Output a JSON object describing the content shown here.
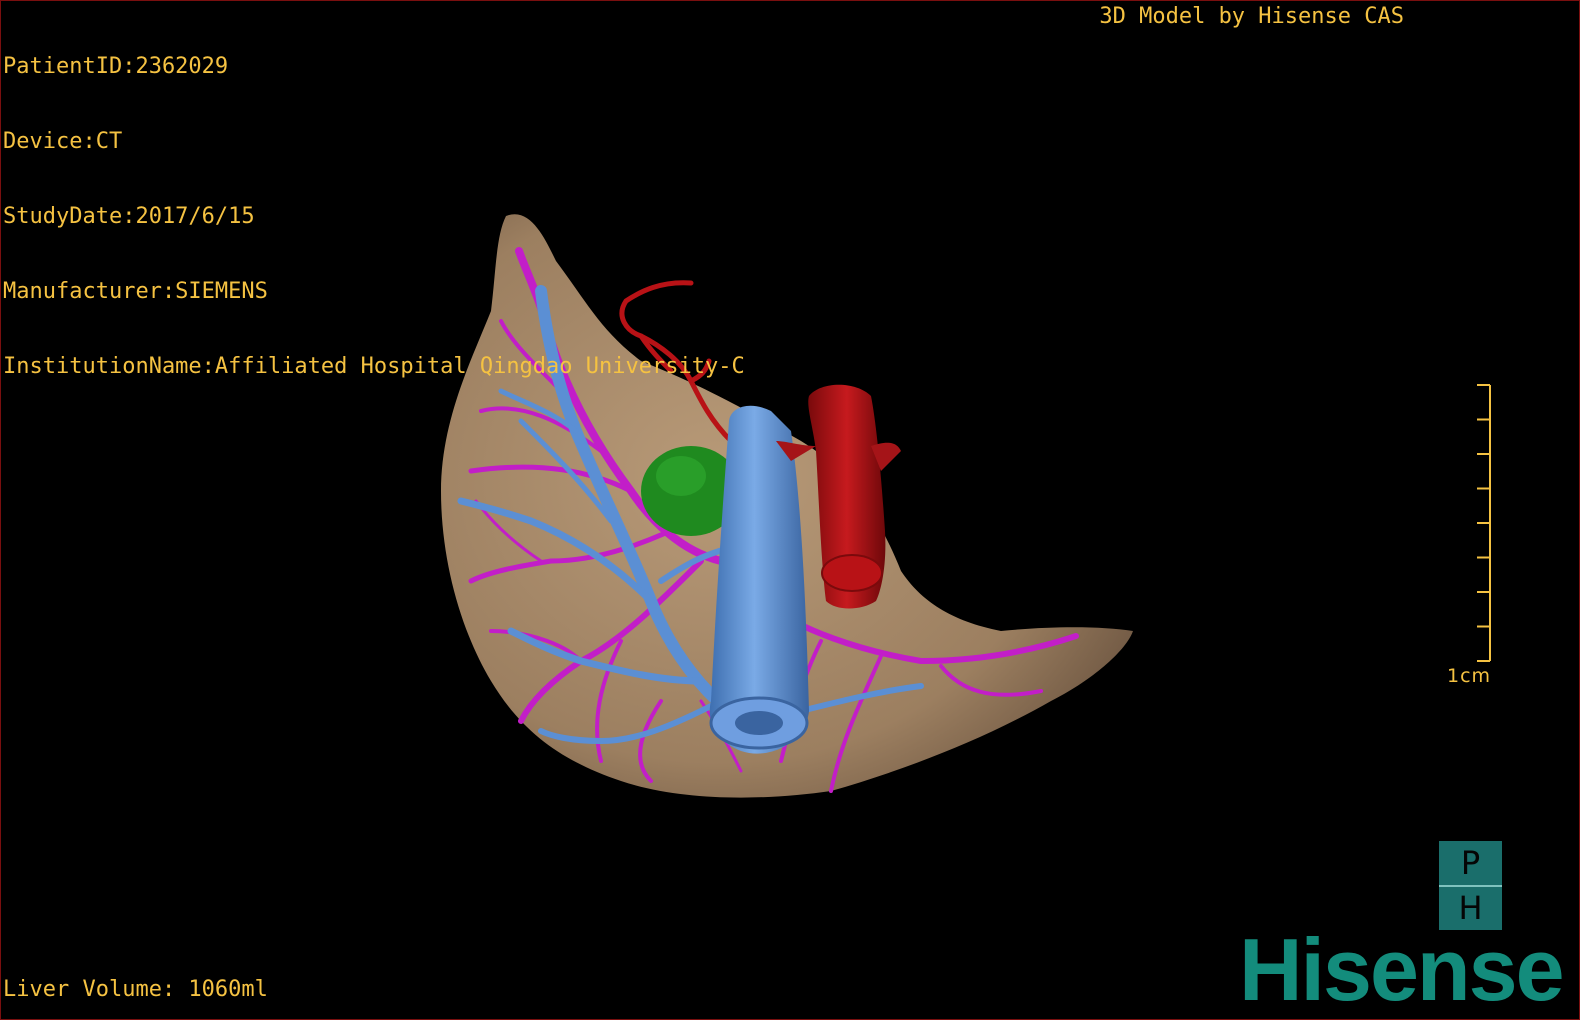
{
  "header": {
    "patient_id": "PatientID:2362029",
    "device": "Device:CT",
    "study_date": "StudyDate:2017/6/15",
    "manufacturer": "Manufacturer:SIEMENS",
    "institution": "InstitutionName:Affiliated Hospital Qingdao University-C",
    "model_credit": "3D Model by Hisense CAS"
  },
  "footer": {
    "liver_volume": "Liver Volume: 1060ml"
  },
  "scale": {
    "label": "1cm",
    "ticks": 9
  },
  "orientation": {
    "top": "P",
    "bottom": "H"
  },
  "logo": {
    "text": "Hisense"
  },
  "colors": {
    "overlay_text": "#f5c242",
    "liver": "#a8896a",
    "portal_vein": "#c21ec8",
    "hepatic_vein": "#5b8fd4",
    "artery": "#b81216",
    "gallbladder": "#1f8a1f",
    "brand": "#138c7c",
    "frame": "#7a0f0f"
  },
  "model": {
    "structures": [
      "liver",
      "hepatic-vein",
      "portal-vein",
      "hepatic-artery",
      "inferior-vena-cava",
      "gallbladder",
      "aorta"
    ]
  }
}
